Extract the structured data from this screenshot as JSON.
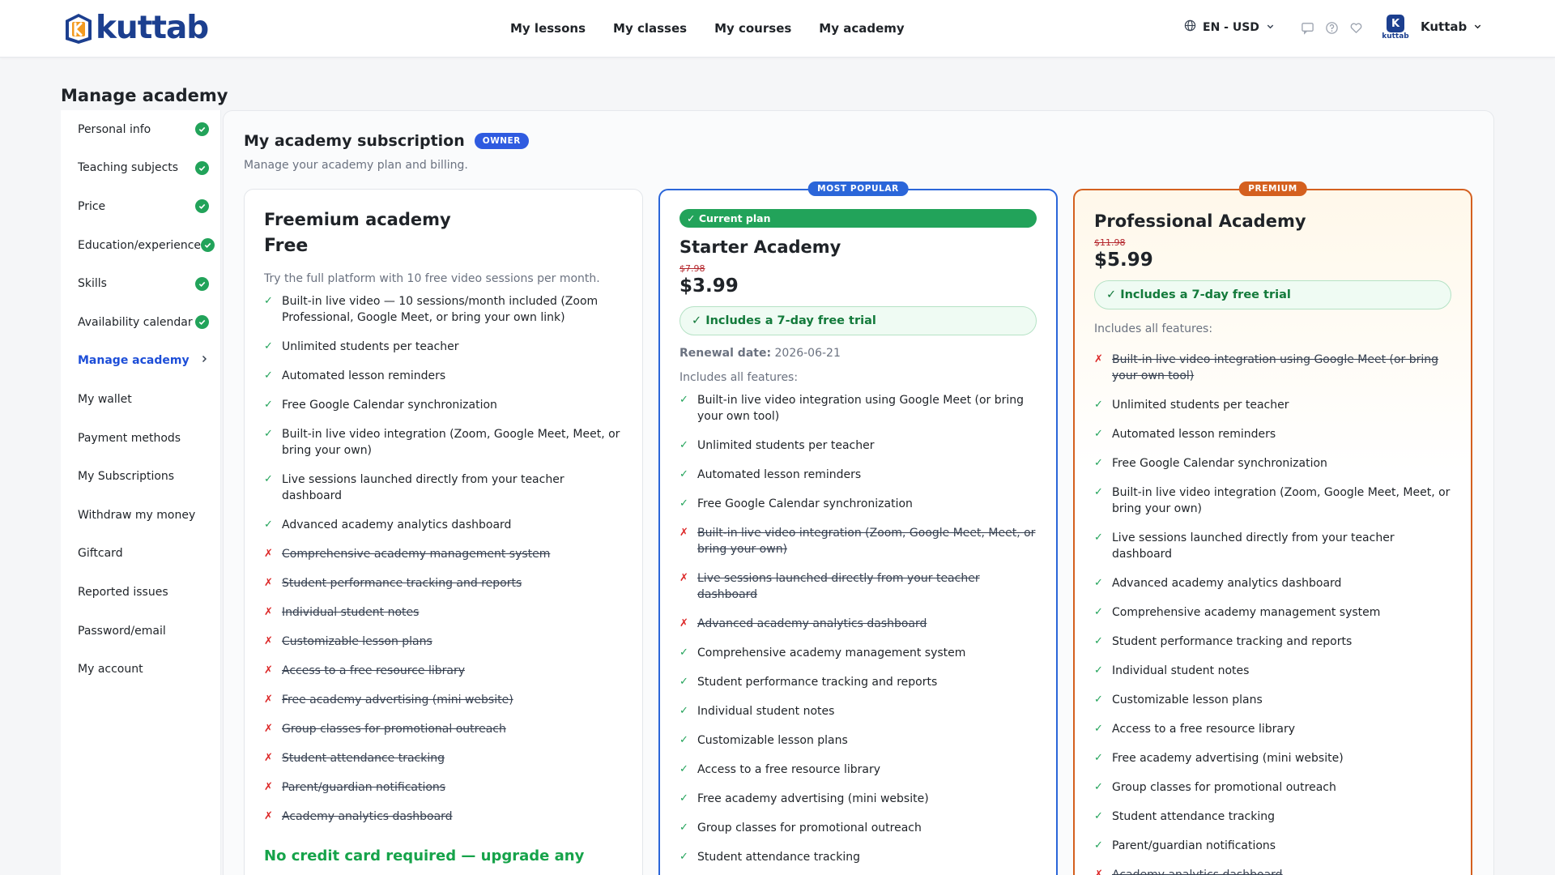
{
  "header": {
    "brand": "kuttab",
    "nav": [
      "My lessons",
      "My classes",
      "My courses",
      "My academy"
    ],
    "locale": "EN - USD",
    "avatar_caption": "kuttab",
    "user_name": "Kuttab"
  },
  "page": {
    "title": "Manage academy"
  },
  "sidebar": {
    "items": [
      {
        "label": "Personal info",
        "complete": true
      },
      {
        "label": "Teaching subjects",
        "complete": true
      },
      {
        "label": "Price",
        "complete": true
      },
      {
        "label": "Education/experience",
        "complete": true
      },
      {
        "label": "Skills",
        "complete": true
      },
      {
        "label": "Availability calendar",
        "complete": true
      },
      {
        "label": "Manage academy",
        "active": true
      },
      {
        "label": "My wallet"
      },
      {
        "label": "Payment methods"
      },
      {
        "label": "My Subscriptions"
      },
      {
        "label": "Withdraw my money"
      },
      {
        "label": "Giftcard"
      },
      {
        "label": "Reported issues"
      },
      {
        "label": "Password/email"
      },
      {
        "label": "My account"
      }
    ]
  },
  "subscription": {
    "title": "My academy subscription",
    "owner_badge": "OWNER",
    "description": "Manage your academy plan and billing."
  },
  "plans": {
    "freemium": {
      "name": "Freemium academy",
      "price": "Free",
      "description": "Try the full platform with 10 free video sessions per month.",
      "features": [
        {
          "text": "Built-in live video — 10 sessions/month included (Zoom Professional, Google Meet, or bring your own link)",
          "included": true
        },
        {
          "text": "Unlimited students per teacher",
          "included": true
        },
        {
          "text": "Automated lesson reminders",
          "included": true
        },
        {
          "text": "Free Google Calendar synchronization",
          "included": true
        },
        {
          "text": "Built-in live video integration (Zoom, Google Meet, Meet, or bring your own)",
          "included": true
        },
        {
          "text": "Live sessions launched directly from your teacher dashboard",
          "included": true
        },
        {
          "text": "Advanced academy analytics dashboard",
          "included": true
        },
        {
          "text": "Comprehensive academy management system",
          "included": false
        },
        {
          "text": "Student performance tracking and reports",
          "included": false
        },
        {
          "text": "Individual student notes",
          "included": false
        },
        {
          "text": "Customizable lesson plans",
          "included": false
        },
        {
          "text": "Access to a free resource library",
          "included": false
        },
        {
          "text": "Free academy advertising (mini website)",
          "included": false
        },
        {
          "text": "Group classes for promotional outreach",
          "included": false
        },
        {
          "text": "Student attendance tracking",
          "included": false
        },
        {
          "text": "Parent/guardian notifications",
          "included": false
        },
        {
          "text": "Academy analytics dashboard",
          "included": false
        }
      ],
      "footer_note": "No credit card required — upgrade any"
    },
    "starter": {
      "tag": "MOST POPULAR",
      "current_label": "✓ Current plan",
      "name": "Starter Academy",
      "old_price": "$7.98",
      "price": "$3.99",
      "trial": "✓ Includes a 7-day free trial",
      "renewal_label": "Renewal date:",
      "renewal_date": "2026-06-21",
      "includes_label": "Includes all features:",
      "features": [
        {
          "text": "Built-in live video integration using Google Meet (or bring your own tool)",
          "included": true
        },
        {
          "text": "Unlimited students per teacher",
          "included": true
        },
        {
          "text": "Automated lesson reminders",
          "included": true
        },
        {
          "text": "Free Google Calendar synchronization",
          "included": true
        },
        {
          "text": "Built-in live video integration (Zoom, Google Meet, Meet, or bring your own)",
          "included": false
        },
        {
          "text": "Live sessions launched directly from your teacher dashboard",
          "included": false
        },
        {
          "text": "Advanced academy analytics dashboard",
          "included": false
        },
        {
          "text": "Comprehensive academy management system",
          "included": true
        },
        {
          "text": "Student performance tracking and reports",
          "included": true
        },
        {
          "text": "Individual student notes",
          "included": true
        },
        {
          "text": "Customizable lesson plans",
          "included": true
        },
        {
          "text": "Access to a free resource library",
          "included": true
        },
        {
          "text": "Free academy advertising (mini website)",
          "included": true
        },
        {
          "text": "Group classes for promotional outreach",
          "included": true
        },
        {
          "text": "Student attendance tracking",
          "included": true
        }
      ]
    },
    "professional": {
      "tag": "PREMIUM",
      "name": "Professional Academy",
      "old_price": "$11.98",
      "price": "$5.99",
      "trial": "✓ Includes a 7-day free trial",
      "includes_label": "Includes all features:",
      "features": [
        {
          "text": "Built-in live video integration using Google Meet (or bring your own tool)",
          "included": false
        },
        {
          "text": "Unlimited students per teacher",
          "included": true
        },
        {
          "text": "Automated lesson reminders",
          "included": true
        },
        {
          "text": "Free Google Calendar synchronization",
          "included": true
        },
        {
          "text": "Built-in live video integration (Zoom, Google Meet, Meet, or bring your own)",
          "included": true
        },
        {
          "text": "Live sessions launched directly from your teacher dashboard",
          "included": true
        },
        {
          "text": "Advanced academy analytics dashboard",
          "included": true
        },
        {
          "text": "Comprehensive academy management system",
          "included": true
        },
        {
          "text": "Student performance tracking and reports",
          "included": true
        },
        {
          "text": "Individual student notes",
          "included": true
        },
        {
          "text": "Customizable lesson plans",
          "included": true
        },
        {
          "text": "Access to a free resource library",
          "included": true
        },
        {
          "text": "Free academy advertising (mini website)",
          "included": true
        },
        {
          "text": "Group classes for promotional outreach",
          "included": true
        },
        {
          "text": "Student attendance tracking",
          "included": true
        },
        {
          "text": "Parent/guardian notifications",
          "included": true
        },
        {
          "text": "Academy analytics dashboard",
          "included": false
        }
      ]
    }
  },
  "colors": {
    "brand": "#1c3f8f",
    "accent": "#2b66d9",
    "success": "#22a35a",
    "danger": "#dc2626",
    "premium": "#d4601f"
  }
}
